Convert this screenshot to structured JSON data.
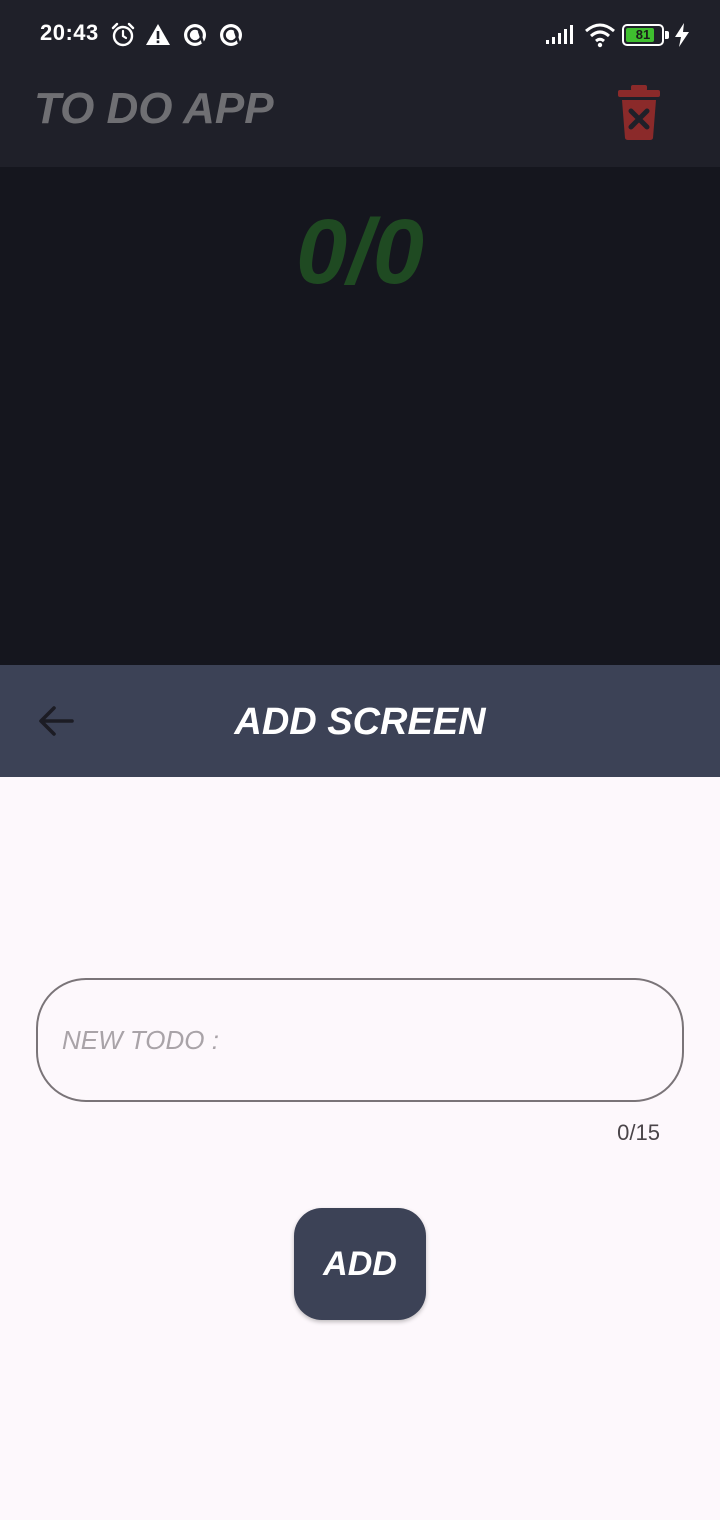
{
  "status_bar": {
    "time": "20:43",
    "icons": [
      "alarm-icon",
      "warning-icon",
      "a-circle-icon",
      "a-circle-icon",
      "signal-icon",
      "wifi-icon",
      "battery-icon",
      "charging-bolt-icon"
    ],
    "battery_level": "81",
    "battery_fraction": 0.81
  },
  "app_bar": {
    "title": "TO DO APP",
    "delete_icon": "trash-x-icon",
    "delete_color": "#8b2a2a"
  },
  "counter": {
    "text": "0/0",
    "color": "#1f4a22"
  },
  "add_screen": {
    "back_icon": "arrow-left-icon",
    "title": "ADD SCREEN",
    "input_placeholder": "NEW TODO :",
    "input_value": "",
    "char_count": "0/15",
    "add_label": "ADD"
  },
  "colors": {
    "header_bg": "#1f2029",
    "content_bg": "#15161e",
    "accent": "#3c4256",
    "sheet_bg": "#fdf8fc"
  }
}
